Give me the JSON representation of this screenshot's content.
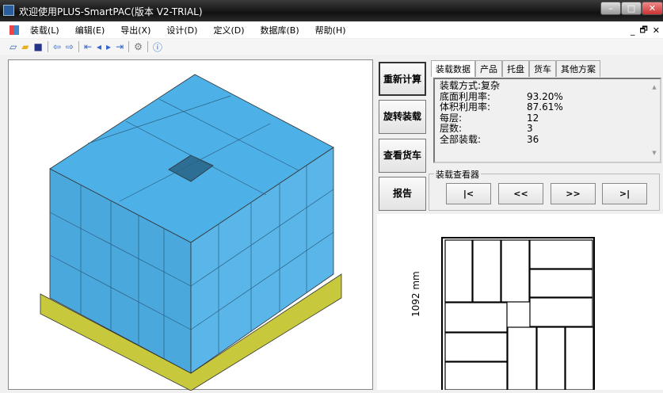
{
  "window": {
    "title": "欢迎使用PLUS-SmartPAC(版本 V2-TRIAL)",
    "min": "–",
    "max": "□",
    "close": "✕",
    "mdi_min": "_",
    "mdi_restore": "🗗",
    "mdi_close": "✕"
  },
  "menu": [
    "装载(L)",
    "编辑(E)",
    "导出(X)",
    "设计(D)",
    "定义(D)",
    "数据库(B)",
    "帮助(H)"
  ],
  "toolbar": [
    "new-icon",
    "open-icon",
    "save-icon",
    "back-icon",
    "forward-icon",
    "first-icon",
    "prev-icon",
    "next-icon",
    "last-icon",
    "settings-icon",
    "help-icon"
  ],
  "side_buttons": [
    "重新计算",
    "旋转装载",
    "查看货车",
    "报告"
  ],
  "tabs": [
    "装载数据",
    "产品",
    "托盘",
    "货车",
    "其他方案"
  ],
  "info": {
    "method": "装载方式:复杂",
    "rows": [
      {
        "k": "底面利用率:",
        "v": "93.20%"
      },
      {
        "k": "体积利用率:",
        "v": "87.61%"
      },
      {
        "k": "每层:",
        "v": "12"
      },
      {
        "k": "层数:",
        "v": "3"
      },
      {
        "k": "全部装载:",
        "v": "36"
      }
    ]
  },
  "viewer": {
    "label": "装载查看器",
    "buttons": [
      "|<",
      "<<",
      ">>",
      ">|"
    ]
  },
  "plan": {
    "dimension": "1092 mm"
  },
  "colors": {
    "box": "#4db0e6",
    "pallet": "#c8c83c"
  }
}
